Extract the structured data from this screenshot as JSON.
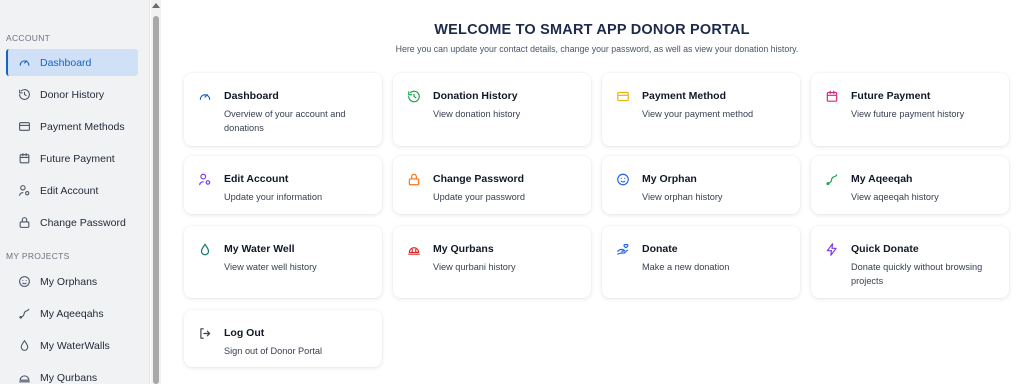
{
  "sidebar": {
    "account_label": "ACCOUNT",
    "projects_label": "MY PROJECTS",
    "account_items": [
      {
        "label": "Dashboard",
        "icon": "gauge-icon"
      },
      {
        "label": "Donor History",
        "icon": "history-icon"
      },
      {
        "label": "Payment Methods",
        "icon": "credit-card-icon"
      },
      {
        "label": "Future Payment",
        "icon": "calendar-icon"
      },
      {
        "label": "Edit Account",
        "icon": "user-edit-icon"
      },
      {
        "label": "Change Password",
        "icon": "lock-icon"
      }
    ],
    "project_items": [
      {
        "label": "My Orphans",
        "icon": "baby-face-icon"
      },
      {
        "label": "My Aqeeqahs",
        "icon": "squiggle-icon"
      },
      {
        "label": "My WaterWalls",
        "icon": "droplet-icon"
      },
      {
        "label": "My Qurbans",
        "icon": "dome-icon"
      }
    ],
    "active": "Dashboard"
  },
  "header": {
    "title": "WELCOME TO SMART APP DONOR PORTAL",
    "subtitle": "Here you can update your contact details, change your password, as well as view your donation history."
  },
  "cards": [
    {
      "title": "Dashboard",
      "desc": "Overview of your account and donations",
      "icon": "gauge-icon",
      "color": "#1565c0"
    },
    {
      "title": "Donation History",
      "desc": "View donation history",
      "icon": "history-icon",
      "color": "#16a34a"
    },
    {
      "title": "Payment Method",
      "desc": "View your payment method",
      "icon": "credit-card-icon",
      "color": "#eab308"
    },
    {
      "title": "Future Payment",
      "desc": "View future payment history",
      "icon": "calendar-icon",
      "color": "#db2777"
    },
    {
      "title": "Edit Account",
      "desc": "Update your information",
      "icon": "user-edit-icon",
      "color": "#7c3aed"
    },
    {
      "title": "Change Password",
      "desc": "Update your password",
      "icon": "lock-icon",
      "color": "#f97316"
    },
    {
      "title": "My Orphan",
      "desc": "View orphan history",
      "icon": "baby-face-icon",
      "color": "#2563eb"
    },
    {
      "title": "My Aqeeqah",
      "desc": "View aqeeqah history",
      "icon": "squiggle-icon",
      "color": "#16a34a"
    },
    {
      "title": "My Water Well",
      "desc": "View water well history",
      "icon": "droplet-icon",
      "color": "#0f766e"
    },
    {
      "title": "My Qurbans",
      "desc": "View qurbani history",
      "icon": "dome-icon",
      "color": "#dc2626"
    },
    {
      "title": "Donate",
      "desc": "Make a new donation",
      "icon": "hand-heart-icon",
      "color": "#2563eb"
    },
    {
      "title": "Quick Donate",
      "desc": "Donate quickly without browsing projects",
      "icon": "lightning-icon",
      "color": "#7c3aed"
    },
    {
      "title": "Log Out",
      "desc": "Sign out of Donor Portal",
      "icon": "logout-icon",
      "color": "#374151"
    }
  ]
}
